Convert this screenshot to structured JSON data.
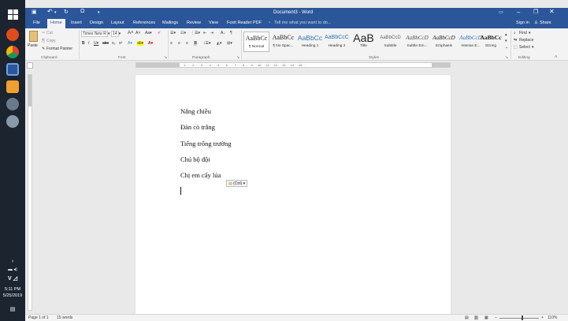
{
  "window": {
    "title": "Document3 - Word",
    "sign_in": "Sign in",
    "share": "Share"
  },
  "qat": {
    "undo_label": "↶",
    "redo_label": "↻",
    "omega_label": "Ω"
  },
  "tabs": [
    {
      "label": "File"
    },
    {
      "label": "Home"
    },
    {
      "label": "Insert"
    },
    {
      "label": "Design"
    },
    {
      "label": "Layout"
    },
    {
      "label": "References"
    },
    {
      "label": "Mailings"
    },
    {
      "label": "Review"
    },
    {
      "label": "View"
    },
    {
      "label": "Foxit Reader PDF"
    }
  ],
  "tell_me": "Tell me what you want to do...",
  "clipboard": {
    "cut": "Cut",
    "copy": "Copy",
    "paste": "Paste",
    "format_painter": "Format Painter",
    "group": "Clipboard"
  },
  "font": {
    "name": "Times New R",
    "size": "14",
    "group": "Font"
  },
  "paragraph": {
    "group": "Paragraph"
  },
  "styles": {
    "group": "Styles",
    "items": [
      {
        "sample": "AaBbCc",
        "name": "¶ Normal"
      },
      {
        "sample": "AaBbCc",
        "name": "¶ No Spac..."
      },
      {
        "sample": "AaBbCc",
        "name": "Heading 1"
      },
      {
        "sample": "AaBbCcC",
        "name": "Heading 2"
      },
      {
        "sample": "AaB",
        "name": "Title"
      },
      {
        "sample": "AaBbCcD",
        "name": "Subtitle"
      },
      {
        "sample": "AaBbCcD",
        "name": "Subtle Em..."
      },
      {
        "sample": "AaBbCcD",
        "name": "Emphasis"
      },
      {
        "sample": "AaBbCcD",
        "name": "Intense E..."
      },
      {
        "sample": "AaBbCc",
        "name": "Strong"
      }
    ]
  },
  "editing": {
    "find": "Find",
    "replace": "Replace",
    "select": "Select",
    "group": "Editing"
  },
  "document": {
    "lines": [
      "Nắng chiều",
      "Đàn cò trắng",
      "Tiếng trống trường",
      "Chú bộ đội",
      "Chị em cấy lúa"
    ],
    "paste_options": "(Ctrl)"
  },
  "status": {
    "page": "Page 1 of 1",
    "words": "15 words",
    "zoom": "110%",
    "zoom_fraction": 0.58
  },
  "taskbar": {
    "time": "5:11 PM",
    "date": "5/25/2019"
  },
  "colors": {
    "word_blue": "#2b579a",
    "taskbar": "#1c2430"
  }
}
